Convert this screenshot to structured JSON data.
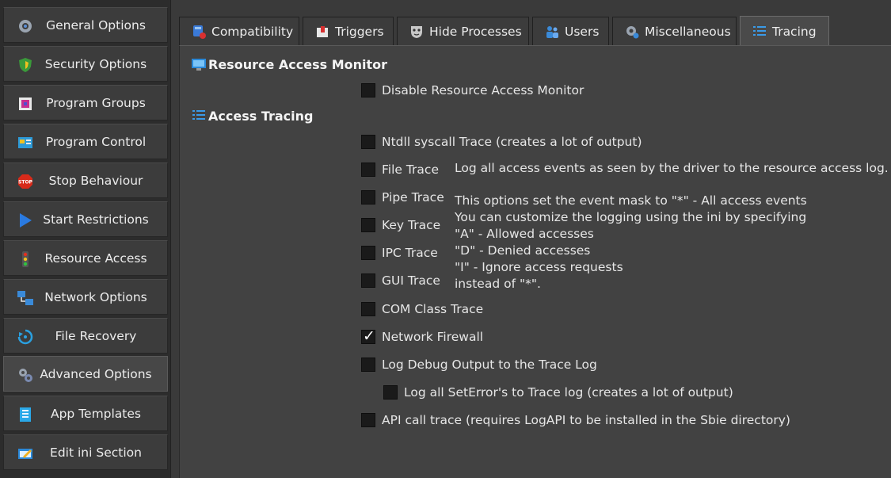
{
  "sidebar": {
    "items": [
      {
        "label": "General Options",
        "icon": "gear-icon",
        "active": false
      },
      {
        "label": "Security Options",
        "icon": "shield-icon",
        "active": false
      },
      {
        "label": "Program Groups",
        "icon": "program-groups-icon",
        "active": false
      },
      {
        "label": "Program Control",
        "icon": "program-control-icon",
        "active": false
      },
      {
        "label": "Stop Behaviour",
        "icon": "stop-sign-icon",
        "active": false
      },
      {
        "label": "Start Restrictions",
        "icon": "play-arrow-icon",
        "active": false
      },
      {
        "label": "Resource Access",
        "icon": "traffic-light-icon",
        "active": false
      },
      {
        "label": "Network Options",
        "icon": "network-icon",
        "active": false
      },
      {
        "label": "File Recovery",
        "icon": "recovery-icon",
        "active": false
      },
      {
        "label": "Advanced Options",
        "icon": "gears-icon",
        "active": true
      },
      {
        "label": "App Templates",
        "icon": "template-icon",
        "active": false
      },
      {
        "label": "Edit ini Section",
        "icon": "edit-icon",
        "active": false
      }
    ]
  },
  "tabs": [
    {
      "label": "Compatibility",
      "icon": "compatibility-icon",
      "active": false
    },
    {
      "label": "Triggers",
      "icon": "triggers-icon",
      "active": false
    },
    {
      "label": "Hide Processes",
      "icon": "mask-icon",
      "active": false
    },
    {
      "label": "Users",
      "icon": "users-icon",
      "active": false
    },
    {
      "label": "Miscellaneous",
      "icon": "misc-gear-icon",
      "active": false
    },
    {
      "label": "Tracing",
      "icon": "list-icon",
      "active": true
    }
  ],
  "tracing": {
    "ram_title": "Resource Access Monitor",
    "disable_ram": {
      "label": "Disable Resource Access Monitor",
      "checked": false
    },
    "access_title": "Access Tracing",
    "ntdll": {
      "label": "Ntdll syscall Trace (creates a lot of output)",
      "checked": false
    },
    "file": {
      "label": "File Trace",
      "checked": false
    },
    "pipe": {
      "label": "Pipe Trace",
      "checked": false
    },
    "key": {
      "label": "Key Trace",
      "checked": false
    },
    "ipc": {
      "label": "IPC Trace",
      "checked": false
    },
    "gui": {
      "label": "GUI Trace",
      "checked": false
    },
    "com": {
      "label": "COM Class Trace",
      "checked": false
    },
    "firewall": {
      "label": "Network Firewall",
      "checked": true
    },
    "debug": {
      "label": "Log Debug Output to the Trace Log",
      "checked": false
    },
    "seterror": {
      "label": "Log all SetError's to Trace log (creates a lot of output)",
      "checked": false
    },
    "apitrace": {
      "label": "API call trace (requires LogAPI to be installed in the Sbie directory)",
      "checked": false
    },
    "info_line1": "Log all access events as seen by the driver to the resource access log.",
    "info_lines": [
      "This options set the event mask to \"*\" - All access events",
      "You can customize the logging using the ini by specifying",
      "\"A\" - Allowed accesses",
      "\"D\" - Denied accesses",
      "\"I\" - Ignore access requests",
      "instead of \"*\"."
    ]
  }
}
